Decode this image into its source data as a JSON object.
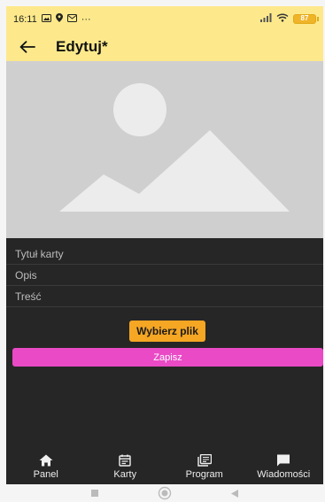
{
  "status_bar": {
    "time": "16:11",
    "more": "···",
    "battery": "87"
  },
  "app_bar": {
    "title": "Edytuj*"
  },
  "form": {
    "title_placeholder": "Tytuł karty",
    "description_placeholder": "Opis",
    "content_placeholder": "Treść",
    "choose_file_label": "Wybierz plik",
    "save_label": "Zapisz"
  },
  "bottom_nav": {
    "items": [
      {
        "label": "Panel",
        "icon": "home-icon"
      },
      {
        "label": "Karty",
        "icon": "calendar-icon"
      },
      {
        "label": "Program",
        "icon": "library-icon"
      },
      {
        "label": "Wiadomości",
        "icon": "message-icon"
      }
    ]
  },
  "colors": {
    "app_bar": "#fde98b",
    "content_bg": "#262626",
    "choose_button": "#f5a623",
    "save_button": "#ea4ac6",
    "placeholder_bg": "#cfcfcf"
  }
}
